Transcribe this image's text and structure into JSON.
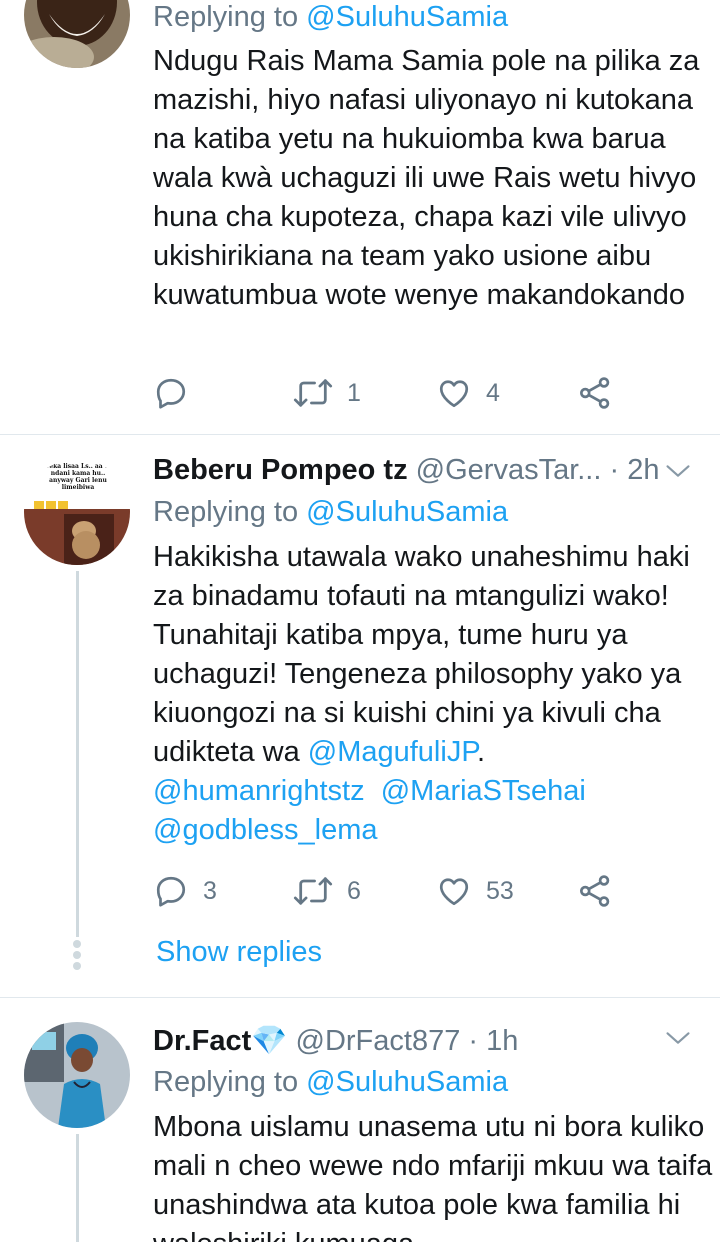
{
  "tweets": [
    {
      "replying_prefix": "Replying to",
      "replying_to": "@SuluhuSamia",
      "text": "Ndugu Rais Mama Samia pole na pilika za mazishi, hiyo nafasi uliyonayo ni kutokana na katiba yetu na hukuiomba kwa barua wala kwà uchaguzi ili uwe Rais wetu hivyo huna cha kupoteza, chapa kazi vile ulivyo ukishirikiana na team yako  usione aibu kuwatumbua wote wenye makandokando",
      "reply_count": "",
      "retweet_count": "1",
      "like_count": "4"
    },
    {
      "name": "Beberu Pompeo tz",
      "handle": "@GervasTar...",
      "time": "· 2h",
      "avatar_text": "weka lisaa Ls.. aa tu ndani kama hu.. anyway Gari lenu limeibiwa",
      "replying_prefix": "Replying to",
      "replying_to": "@SuluhuSamia",
      "text_part1": "Hakikisha utawala wako unaheshimu haki za binadamu tofauti na mtangulizi wako! Tunahitaji katiba mpya, tume huru ya uchaguzi! Tengeneza philosophy yako ya kiuongozi na si kuishi chini ya kivuli cha udikteta wa ",
      "mention1": "@MagufuliJP",
      "text_part2": ".",
      "mention2": "@humanrightstz",
      "mention3": "@MariaSTsehai",
      "mention4": "@godbless_lema",
      "reply_count": "3",
      "retweet_count": "6",
      "like_count": "53",
      "show_replies": "Show replies"
    },
    {
      "name": "Dr.Fact",
      "name_emoji": "💎",
      "handle": "@DrFact877",
      "time": "· 1h",
      "replying_prefix": "Replying to",
      "replying_to": "@SuluhuSamia",
      "text": "Mbona uislamu unasema utu ni bora kuliko mali n cheo wewe ndo mfariji mkuu wa taifa unashindwa ata kutoa pole kwa familia hi waloshiriki kumuaga"
    }
  ],
  "colors": {
    "link": "#1da1f2",
    "muted": "#657786",
    "text": "#14171a",
    "divider": "#e1e8ed",
    "thread": "#cfd9de"
  },
  "icons": [
    "reply-icon",
    "retweet-icon",
    "like-icon",
    "share-icon",
    "chevron-down-icon",
    "gem-emoji"
  ]
}
